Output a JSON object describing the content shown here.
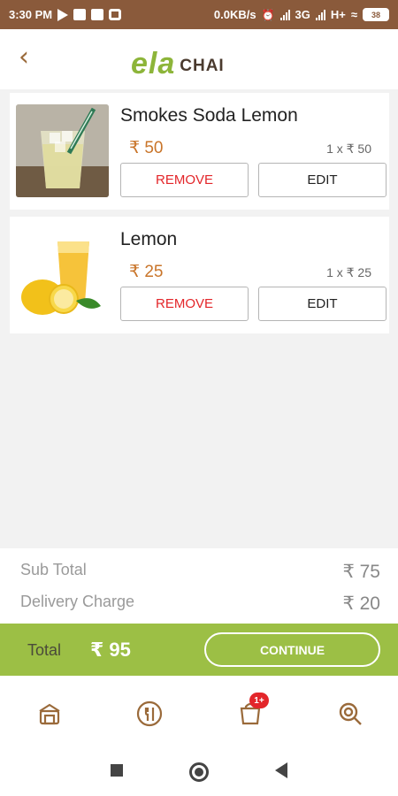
{
  "status_bar": {
    "time": "3:30 PM",
    "speed": "0.0KB/s",
    "network": "3G",
    "network2": "H+",
    "battery": "38"
  },
  "header": {
    "logo_main": "ELA",
    "logo_sub": "CHAI"
  },
  "cart": {
    "items": [
      {
        "name": "Smokes Soda Lemon",
        "price": "₹ 50",
        "qty_line": "1 x ₹ 50",
        "remove_label": "REMOVE",
        "edit_label": "EDIT"
      },
      {
        "name": "Lemon",
        "price": "₹ 25",
        "qty_line": "1 x ₹ 25",
        "remove_label": "REMOVE",
        "edit_label": "EDIT"
      }
    ]
  },
  "summary": {
    "sub_total_label": "Sub Total",
    "sub_total_value": "₹ 75",
    "delivery_label": "Delivery Charge",
    "delivery_value": "₹ 20",
    "total_label": "Total",
    "total_value": "₹ 95",
    "continue_label": "CONTINUE"
  },
  "bottom_nav": {
    "items": [
      {
        "icon": "store-icon"
      },
      {
        "icon": "menu-fork-icon"
      },
      {
        "icon": "cart-icon",
        "badge": "1+"
      },
      {
        "icon": "search-icon"
      }
    ]
  },
  "colors": {
    "status_bar": "#8a5a3b",
    "accent_green": "#9cbf45",
    "price_orange": "#c9752a",
    "remove_red": "#e3262a",
    "brown": "#9a6a3a"
  }
}
